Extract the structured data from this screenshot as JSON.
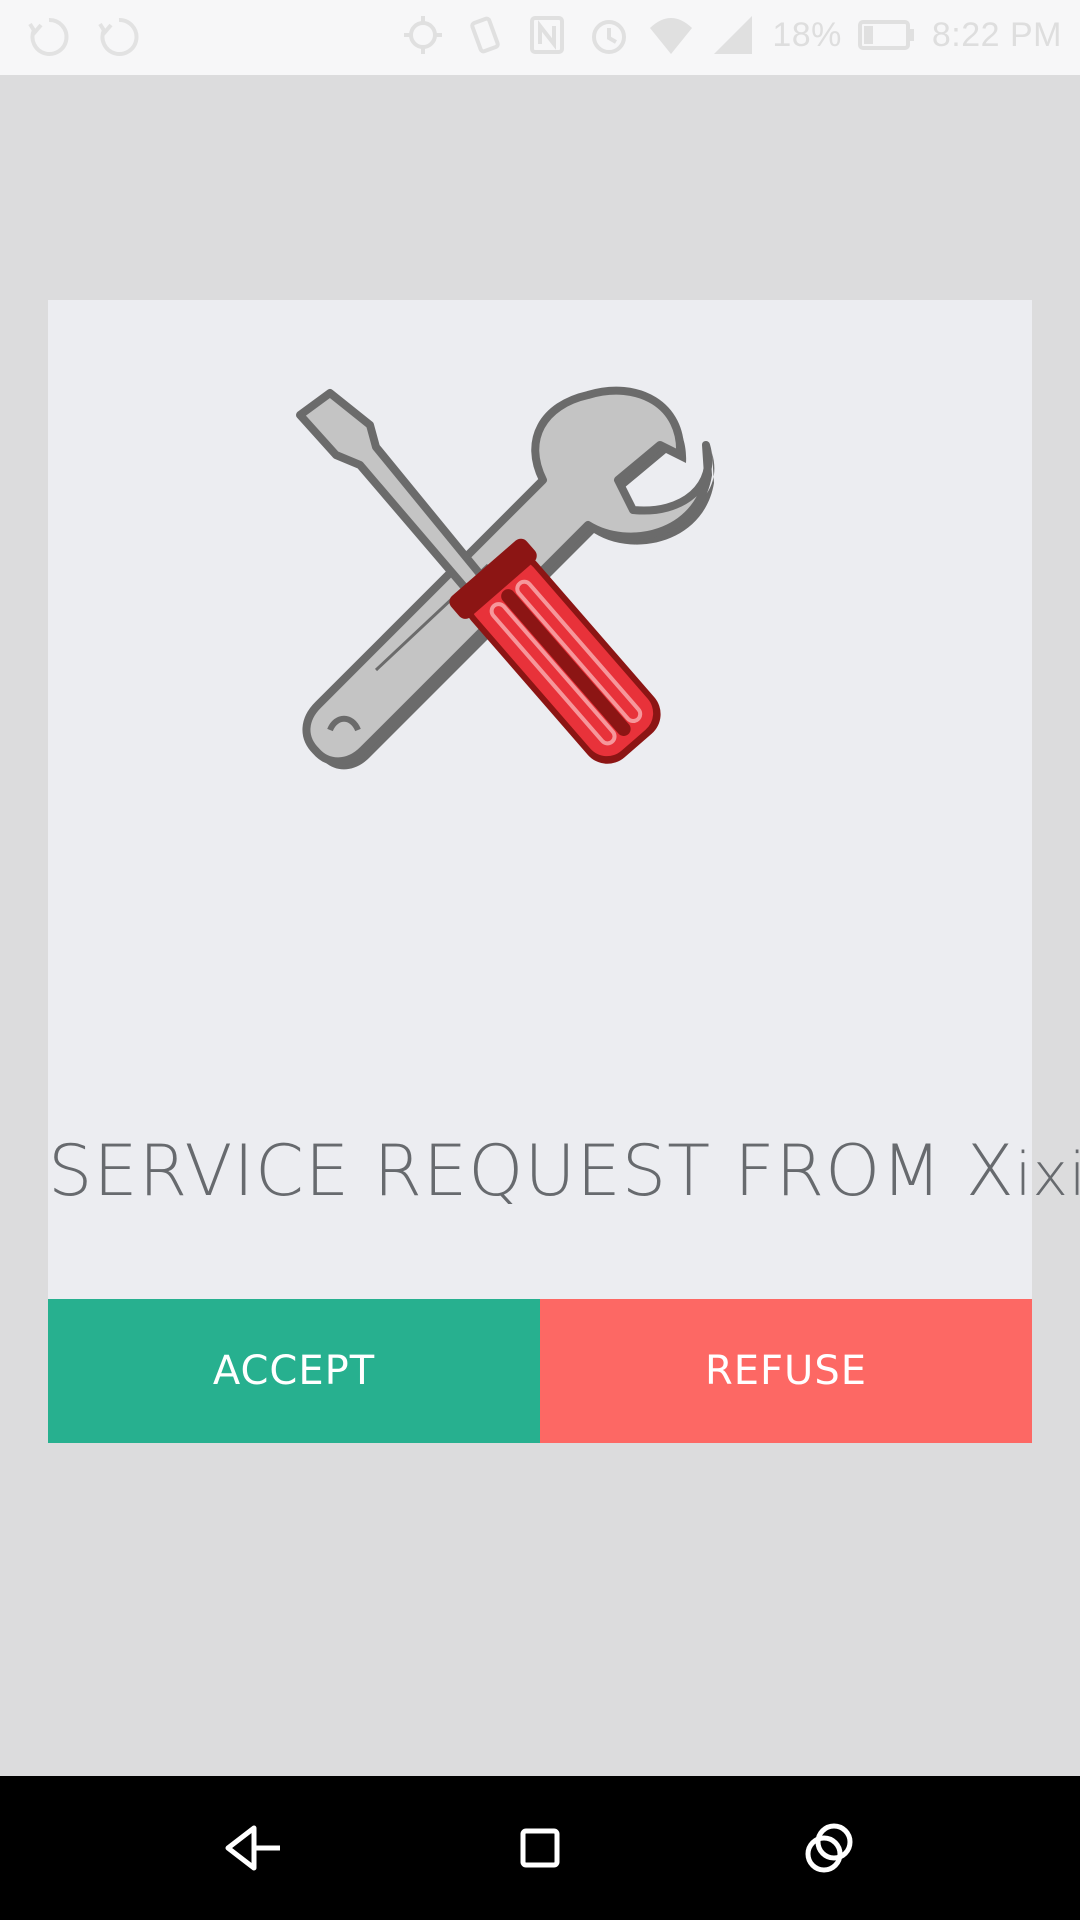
{
  "status_bar": {
    "battery": "18%",
    "time": "8:22 PM",
    "icons": [
      "sync-icon",
      "sync-icon",
      "location-icon",
      "vibrate-icon",
      "nfc-icon",
      "alarm-icon",
      "wifi-icon",
      "signal-icon",
      "battery-icon"
    ]
  },
  "request": {
    "title_prefix": "SERVICE REQUEST FROM X",
    "title_suffix": "ixi",
    "illustration": "wrench-screwdriver-icon"
  },
  "actions": {
    "accept_label": "ACCEPT",
    "refuse_label": "REFUSE"
  },
  "navigation": {
    "buttons": [
      "back-icon",
      "home-icon",
      "recents-icon"
    ]
  },
  "colors": {
    "accept": "#27b08f",
    "refuse": "#fd6864",
    "title_text": "#676a6e",
    "card_background": "#ecedf1",
    "page_background": "#dcdcdd"
  }
}
